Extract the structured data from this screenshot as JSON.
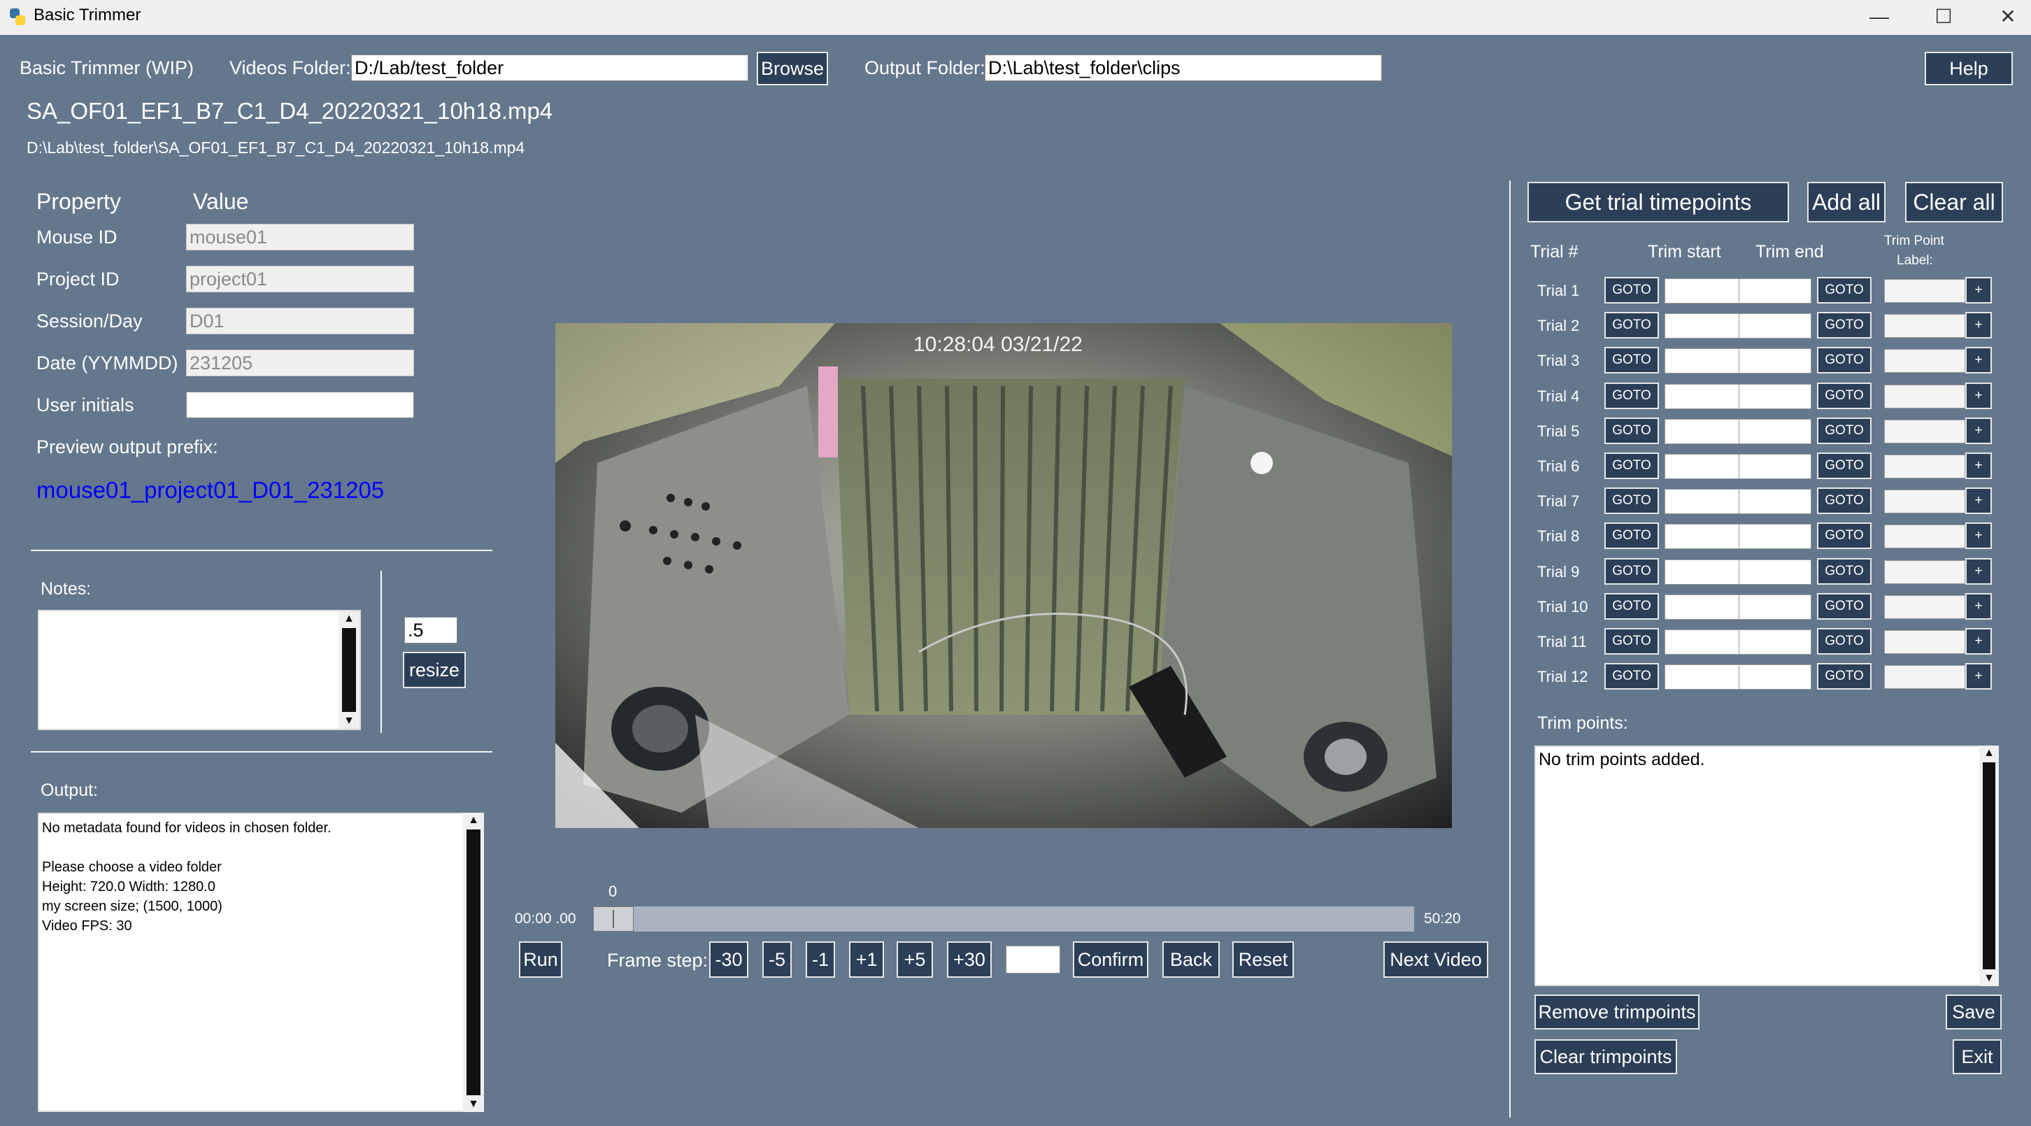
{
  "window": {
    "title": "Basic Trimmer",
    "minimize_glyph": "—",
    "maximize_glyph": "☐",
    "close_glyph": "✕"
  },
  "toolbar": {
    "app_label": "Basic Trimmer (WIP)",
    "videos_folder_label": "Videos Folder:",
    "videos_folder_value": "D:/Lab/test_folder",
    "browse_label": "Browse",
    "output_folder_label": "Output Folder:",
    "output_folder_value": "D:\\Lab\\test_folder\\clips",
    "help_label": "Help"
  },
  "video": {
    "filename": "SA_OF01_EF1_B7_C1_D4_20220321_10h18.mp4",
    "full_path": "D:\\Lab\\test_folder\\SA_OF01_EF1_B7_C1_D4_20220321_10h18.mp4",
    "overlay_timestamp": "10:28:04  03/21/22"
  },
  "properties": {
    "header_property": "Property",
    "header_value": "Value",
    "rows": [
      {
        "label": "Mouse ID",
        "value": "mouse01"
      },
      {
        "label": "Project ID",
        "value": "project01"
      },
      {
        "label": "Session/Day",
        "value": "D01"
      },
      {
        "label": "Date (YYMMDD)",
        "value": "231205"
      },
      {
        "label": "User initials",
        "value": ""
      }
    ],
    "preview_label": "Preview output prefix:",
    "preview_value": "mouse01_project01_D01_231205"
  },
  "notes": {
    "label": "Notes:",
    "value": ""
  },
  "resize": {
    "value": ".5",
    "button_label": "resize"
  },
  "output": {
    "label": "Output:",
    "lines": [
      "No metadata found for videos in chosen folder.",
      "",
      "Please choose a video folder",
      "Height:  720.0  Width:  1280.0",
      "my screen size;  (1500, 1000)",
      "Video FPS:  30"
    ]
  },
  "playback": {
    "slider_value": "0",
    "slider_fraction": 0.0,
    "time_start": "00:00 .00",
    "time_end": "50:20",
    "run_label": "Run",
    "frame_step_label": "Frame step:",
    "steps": [
      "-30",
      "-5",
      "-1",
      "+1",
      "+5",
      "+30"
    ],
    "step_value": "",
    "confirm_label": "Confirm",
    "back_label": "Back",
    "reset_label": "Reset",
    "next_video_label": "Next Video"
  },
  "trials": {
    "get_timepoints_label": "Get trial timepoints",
    "add_all_label": "Add all",
    "clear_all_label": "Clear all",
    "header_trial": "Trial #",
    "header_start": "Trim start",
    "header_end": "Trim end",
    "header_label_1": "Trim Point",
    "header_label_2": "Label:",
    "goto_label": "GOTO",
    "plus_label": "+",
    "rows": [
      {
        "label": "Trial 1"
      },
      {
        "label": "Trial 2"
      },
      {
        "label": "Trial 3"
      },
      {
        "label": "Trial 4"
      },
      {
        "label": "Trial 5"
      },
      {
        "label": "Trial 6"
      },
      {
        "label": "Trial 7"
      },
      {
        "label": "Trial 8"
      },
      {
        "label": "Trial 9"
      },
      {
        "label": "Trial 10"
      },
      {
        "label": "Trial 11"
      },
      {
        "label": "Trial 12"
      }
    ],
    "trim_points_label": "Trim points:",
    "trim_points_text": "No trim points added.",
    "remove_label": "Remove trimpoints",
    "save_label": "Save",
    "clear_label": "Clear trimpoints",
    "exit_label": "Exit"
  },
  "colors": {
    "background": "#64778d",
    "button": "#2c3e58",
    "preview_link": "#0000ff"
  },
  "icons": {
    "app": "python-icon",
    "scroll_up": "▲",
    "scroll_down": "▼"
  }
}
